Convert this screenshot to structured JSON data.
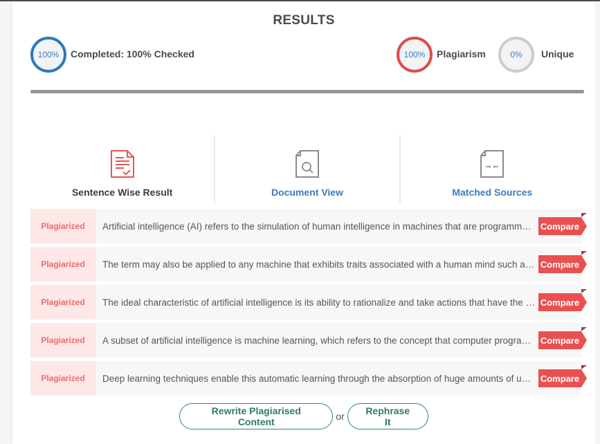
{
  "header": {
    "title": "RESULTS"
  },
  "stats": {
    "completed": {
      "value": "100%",
      "label": "Completed: 100% Checked",
      "color": "#2f78bb"
    },
    "plagiarism": {
      "value": "100%",
      "label": "Plagiarism",
      "color": "#e04b4b"
    },
    "unique": {
      "value": "0%",
      "label": "Unique",
      "color": "#cccccc"
    }
  },
  "progress": {
    "percent": 100
  },
  "tabs": [
    {
      "label": "Sentence Wise Result",
      "icon": "document-check-icon",
      "active": true
    },
    {
      "label": "Document View",
      "icon": "document-search-icon",
      "active": false
    },
    {
      "label": "Matched Sources",
      "icon": "document-compare-icon",
      "active": false
    }
  ],
  "results": [
    {
      "status": "Plagiarized",
      "text": "Artificial intelligence (AI) refers to the simulation of human intelligence in machines that are programmed to think like humans and mimic their actions.",
      "action": "Compare"
    },
    {
      "status": "Plagiarized",
      "text": "The term may also be applied to any machine that exhibits traits associated with a human mind such as learning and problem-solving.",
      "action": "Compare"
    },
    {
      "status": "Plagiarized",
      "text": "The ideal characteristic of artificial intelligence is its ability to rationalize and take actions that have the best chance of achieving a specific goal.",
      "action": "Compare"
    },
    {
      "status": "Plagiarized",
      "text": "A subset of artificial intelligence is machine learning, which refers to the concept that computer programs can automatically learn from and adapt to new data.",
      "action": "Compare"
    },
    {
      "status": "Plagiarized",
      "text": "Deep learning techniques enable this automatic learning through the absorption of huge amounts of unstructured data.",
      "action": "Compare"
    }
  ],
  "actions": {
    "rewrite_label": "Rewrite Plagiarised Content",
    "or_label": "or",
    "rephrase_label": "Rephrase It"
  }
}
